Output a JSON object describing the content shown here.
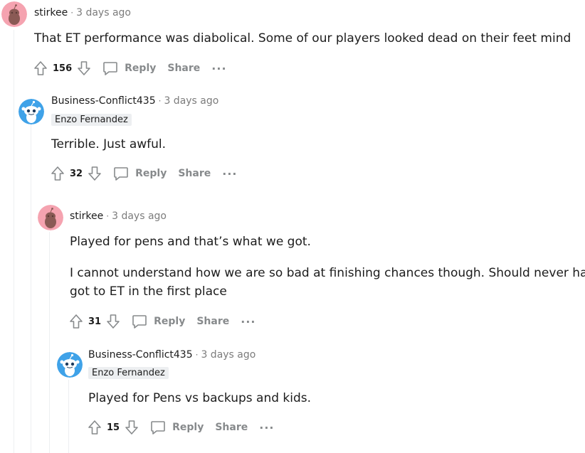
{
  "comments": [
    {
      "author": "stirkee",
      "separator": "·",
      "time": "3 days ago",
      "flair": "",
      "body": [
        "That ET performance was diabolical. Some of our players looked dead on their feet mind"
      ],
      "votes": "156",
      "reply_label": "Reply",
      "share_label": "Share",
      "more_label": "···",
      "avatar_color": "#f5a3b0"
    },
    {
      "author": "Business-Conflict435",
      "separator": "·",
      "time": "3 days ago",
      "flair": "Enzo Fernandez",
      "body": [
        "Terrible. Just awful."
      ],
      "votes": "32",
      "reply_label": "Reply",
      "share_label": "Share",
      "more_label": "···",
      "avatar_color": "#3fa2e8"
    },
    {
      "author": "stirkee",
      "separator": "·",
      "time": "3 days ago",
      "flair": "",
      "body": [
        "Played for pens and that’s what we got.",
        "I cannot understand how we are so bad at finishing chances though. Should never have",
        "got to ET in the first place"
      ],
      "votes": "31",
      "reply_label": "Reply",
      "share_label": "Share",
      "more_label": "···",
      "avatar_color": "#f5a3b0"
    },
    {
      "author": "Business-Conflict435",
      "separator": "·",
      "time": "3 days ago",
      "flair": "Enzo Fernandez",
      "body": [
        "Played for Pens vs backups and kids."
      ],
      "votes": "15",
      "reply_label": "Reply",
      "share_label": "Share",
      "more_label": "···",
      "avatar_color": "#3fa2e8"
    }
  ],
  "icons": {
    "upvote": "upvote-arrow-icon",
    "downvote": "downvote-arrow-icon",
    "reply": "speech-bubble-icon",
    "more": "ellipsis-icon"
  },
  "colors": {
    "meta_text": "#7c7c7c",
    "action_text": "#878a8c",
    "thread_line": "#edeff1",
    "flair_bg": "#edeff1"
  }
}
